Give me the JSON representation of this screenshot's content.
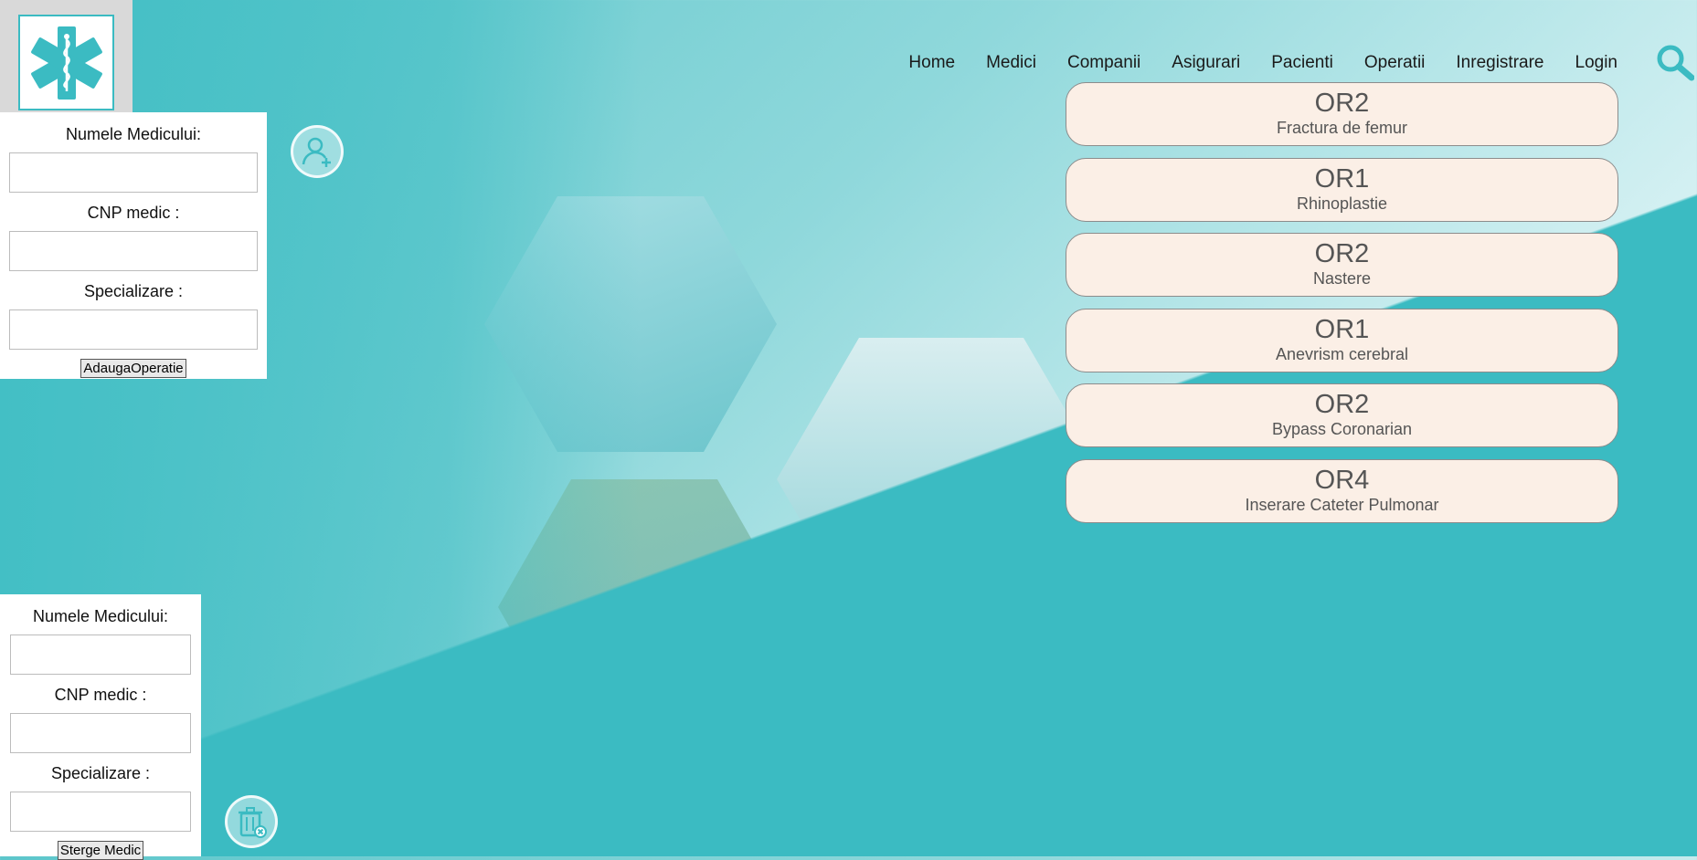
{
  "colors": {
    "accent": "#3bbbc2",
    "card_bg": "#fbefe6",
    "panel_bg": "#ffffff"
  },
  "logo": {
    "icon": "star-of-life-icon"
  },
  "nav": {
    "items": [
      "Home",
      "Medici",
      "Companii",
      "Asigurari",
      "Pacienti",
      "Operatii",
      "Inregistrare",
      "Login"
    ],
    "search_icon": "search-icon"
  },
  "add_form": {
    "name_label": "Numele Medicului:",
    "name_value": "",
    "cnp_label": "CNP medic :",
    "cnp_value": "",
    "spec_label": "Specializare :",
    "spec_value": "",
    "button_label": "AdaugaOperatie",
    "icon": "add-user-icon"
  },
  "delete_form": {
    "name_label": "Numele Medicului:",
    "name_value": "",
    "cnp_label": "CNP medic :",
    "cnp_value": "",
    "spec_label": "Specializare :",
    "spec_value": "",
    "button_label": "Sterge Medic",
    "icon": "trash-icon"
  },
  "operations": [
    {
      "room": "OR2",
      "name": "Fractura de femur"
    },
    {
      "room": "OR1",
      "name": "Rhinoplastie"
    },
    {
      "room": "OR2",
      "name": "Nastere"
    },
    {
      "room": "OR1",
      "name": "Anevrism cerebral"
    },
    {
      "room": "OR2",
      "name": "Bypass Coronarian"
    },
    {
      "room": "OR4",
      "name": "Inserare Cateter Pulmonar"
    }
  ]
}
